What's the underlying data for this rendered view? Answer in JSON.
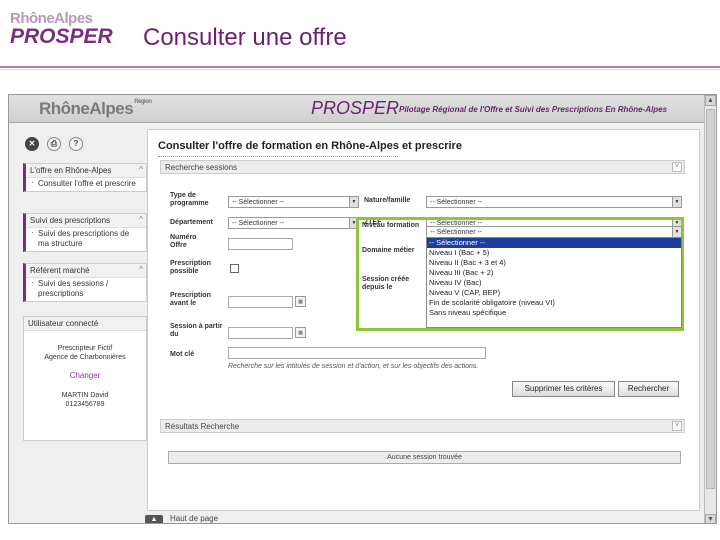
{
  "slide": {
    "brand_top": "RhôneAlpes",
    "brand_bottom": "PROSPER",
    "title": "Consulter une offre"
  },
  "app": {
    "logo": "RhôneAlpes",
    "logo_sup": "Région",
    "prosper": "PROSPER",
    "tagline": "Pilotage Régional de l'Offre et Suivi des Prescriptions En Rhône-Alpes"
  },
  "toolbar": {
    "close_icon_glyph": "✕",
    "print_icon_glyph": "⎙",
    "help_icon_glyph": "?"
  },
  "sidebar": {
    "menus": [
      {
        "title": "L'offre en Rhône-Alpes",
        "items": [
          "Consulter l'offre et prescrire"
        ]
      },
      {
        "title": "Suivi des prescriptions",
        "items": [
          "Suivi des prescriptions de ma structure"
        ]
      },
      {
        "title": "Référent marché",
        "items": [
          "Suivi des sessions / prescriptions"
        ]
      }
    ],
    "user": {
      "title": "Utilisateur connecté",
      "name": "Prescripteur Fictif",
      "agency": "Agence de Charbonnières",
      "change": "Changer",
      "contact_name": "MARTIN David",
      "phone": "0123456789"
    },
    "back_top": "Haut de page"
  },
  "main": {
    "title": "Consulter l'offre de formation en Rhône-Alpes et prescrire",
    "search_section": "Recherche sessions",
    "fields": {
      "type_programme": {
        "label": "Type de programme",
        "value": "-- Sélectionner --"
      },
      "nature_famille": {
        "label": "Nature/famille",
        "value": "-- Sélectionner --"
      },
      "departement": {
        "label": "Département",
        "value": "-- Sélectionner --"
      },
      "ztef": {
        "label": "ZTEF",
        "value": "-- Sélectionner --"
      },
      "numero_offre": {
        "label": "Numéro Offre"
      },
      "niveau_formation": {
        "label": "Niveau formation",
        "value": "-- Sélectionner --"
      },
      "prescription_possible": {
        "label": "Prescription possible"
      },
      "domaine_metier": {
        "label": "Domaine métier"
      },
      "prescription_avant": {
        "label": "Prescription avant le"
      },
      "session_creee": {
        "label": "Session créée depuis le"
      },
      "session_partir": {
        "label": "Session à partir du"
      },
      "mot_cle": {
        "label": "Mot clé"
      }
    },
    "niveau_options": [
      "-- Sélectionner --",
      "Niveau I (Bac + 5)",
      "Niveau II (Bac + 3 et 4)",
      "Niveau III (Bac + 2)",
      "Niveau IV (Bac)",
      "Niveau V (CAP, BEP)",
      "Fin de scolarité obligatoire (niveau VI)",
      "Sans niveau spécifique"
    ],
    "hint": "Recherche sur les intitulés de session et d'action, et sur les objectifs des actions.",
    "btn_clear": "Supprimer les critères",
    "btn_search": "Rechercher",
    "results_section": "Résultats Recherche",
    "no_results": "Aucune session trouvée"
  },
  "colors": {
    "brand_purple": "#7b2d82",
    "highlight_green": "#8cc63f",
    "selection_blue": "#1c3f9c"
  }
}
